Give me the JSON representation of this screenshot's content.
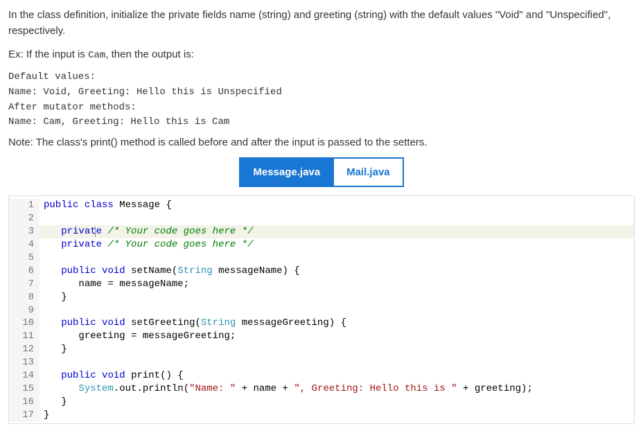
{
  "instructions": {
    "para1": "In the class definition, initialize the private fields name (string) and greeting (string) with the default values \"Void\" and \"Unspecified\", respectively.",
    "ex_prefix": "Ex: If the input is ",
    "ex_input": "Cam",
    "ex_suffix": ", then the output is:",
    "output": "Default values:\nName: Void, Greeting: Hello this is Unspecified\nAfter mutator methods:\nName: Cam, Greeting: Hello this is Cam",
    "note": "Note: The class's print() method is called before and after the input is passed to the setters."
  },
  "tabs": {
    "active": "Message.java",
    "inactive": "Mail.java"
  },
  "code": {
    "lines": [
      {
        "n": "1",
        "hl": false,
        "cursor": false,
        "indent": 0,
        "tokens": [
          {
            "c": "kw",
            "t": "public"
          },
          {
            "c": "sp",
            "t": " "
          },
          {
            "c": "kw",
            "t": "class"
          },
          {
            "c": "sp",
            "t": " "
          },
          {
            "c": "ident",
            "t": "Message"
          },
          {
            "c": "sp",
            "t": " "
          },
          {
            "c": "op",
            "t": "{"
          }
        ]
      },
      {
        "n": "2",
        "hl": false,
        "cursor": false,
        "indent": 0,
        "tokens": []
      },
      {
        "n": "3",
        "hl": true,
        "cursor": true,
        "indent": 1,
        "tokens": [
          {
            "c": "kw",
            "t": "private"
          },
          {
            "c": "sp",
            "t": " "
          },
          {
            "c": "cmt",
            "t": "/* Your code goes here */"
          }
        ]
      },
      {
        "n": "4",
        "hl": false,
        "cursor": false,
        "indent": 1,
        "tokens": [
          {
            "c": "kw",
            "t": "private"
          },
          {
            "c": "sp",
            "t": " "
          },
          {
            "c": "cmt",
            "t": "/* Your code goes here */"
          }
        ]
      },
      {
        "n": "5",
        "hl": false,
        "cursor": false,
        "indent": 0,
        "tokens": []
      },
      {
        "n": "6",
        "hl": false,
        "cursor": false,
        "indent": 1,
        "tokens": [
          {
            "c": "kw",
            "t": "public"
          },
          {
            "c": "sp",
            "t": " "
          },
          {
            "c": "kw",
            "t": "void"
          },
          {
            "c": "sp",
            "t": " "
          },
          {
            "c": "ident",
            "t": "setName"
          },
          {
            "c": "op",
            "t": "("
          },
          {
            "c": "type",
            "t": "String"
          },
          {
            "c": "sp",
            "t": " "
          },
          {
            "c": "ident",
            "t": "messageName"
          },
          {
            "c": "op",
            "t": ")"
          },
          {
            "c": "sp",
            "t": " "
          },
          {
            "c": "op",
            "t": "{"
          }
        ]
      },
      {
        "n": "7",
        "hl": false,
        "cursor": false,
        "indent": 2,
        "tokens": [
          {
            "c": "ident",
            "t": "name"
          },
          {
            "c": "sp",
            "t": " "
          },
          {
            "c": "op",
            "t": "="
          },
          {
            "c": "sp",
            "t": " "
          },
          {
            "c": "ident",
            "t": "messageName"
          },
          {
            "c": "op",
            "t": ";"
          }
        ]
      },
      {
        "n": "8",
        "hl": false,
        "cursor": false,
        "indent": 1,
        "tokens": [
          {
            "c": "op",
            "t": "}"
          }
        ]
      },
      {
        "n": "9",
        "hl": false,
        "cursor": false,
        "indent": 0,
        "tokens": []
      },
      {
        "n": "10",
        "hl": false,
        "cursor": false,
        "indent": 1,
        "tokens": [
          {
            "c": "kw",
            "t": "public"
          },
          {
            "c": "sp",
            "t": " "
          },
          {
            "c": "kw",
            "t": "void"
          },
          {
            "c": "sp",
            "t": " "
          },
          {
            "c": "ident",
            "t": "setGreeting"
          },
          {
            "c": "op",
            "t": "("
          },
          {
            "c": "type",
            "t": "String"
          },
          {
            "c": "sp",
            "t": " "
          },
          {
            "c": "ident",
            "t": "messageGreeting"
          },
          {
            "c": "op",
            "t": ")"
          },
          {
            "c": "sp",
            "t": " "
          },
          {
            "c": "op",
            "t": "{"
          }
        ]
      },
      {
        "n": "11",
        "hl": false,
        "cursor": false,
        "indent": 2,
        "tokens": [
          {
            "c": "ident",
            "t": "greeting"
          },
          {
            "c": "sp",
            "t": " "
          },
          {
            "c": "op",
            "t": "="
          },
          {
            "c": "sp",
            "t": " "
          },
          {
            "c": "ident",
            "t": "messageGreeting"
          },
          {
            "c": "op",
            "t": ";"
          }
        ]
      },
      {
        "n": "12",
        "hl": false,
        "cursor": false,
        "indent": 1,
        "tokens": [
          {
            "c": "op",
            "t": "}"
          }
        ]
      },
      {
        "n": "13",
        "hl": false,
        "cursor": false,
        "indent": 0,
        "tokens": []
      },
      {
        "n": "14",
        "hl": false,
        "cursor": false,
        "indent": 1,
        "tokens": [
          {
            "c": "kw",
            "t": "public"
          },
          {
            "c": "sp",
            "t": " "
          },
          {
            "c": "kw",
            "t": "void"
          },
          {
            "c": "sp",
            "t": " "
          },
          {
            "c": "ident",
            "t": "print"
          },
          {
            "c": "op",
            "t": "()"
          },
          {
            "c": "sp",
            "t": " "
          },
          {
            "c": "op",
            "t": "{"
          }
        ]
      },
      {
        "n": "15",
        "hl": false,
        "cursor": false,
        "indent": 2,
        "tokens": [
          {
            "c": "type",
            "t": "System"
          },
          {
            "c": "op",
            "t": "."
          },
          {
            "c": "ident",
            "t": "out"
          },
          {
            "c": "op",
            "t": "."
          },
          {
            "c": "ident",
            "t": "println"
          },
          {
            "c": "op",
            "t": "("
          },
          {
            "c": "str",
            "t": "\"Name: \""
          },
          {
            "c": "sp",
            "t": " "
          },
          {
            "c": "op",
            "t": "+"
          },
          {
            "c": "sp",
            "t": " "
          },
          {
            "c": "ident",
            "t": "name"
          },
          {
            "c": "sp",
            "t": " "
          },
          {
            "c": "op",
            "t": "+"
          },
          {
            "c": "sp",
            "t": " "
          },
          {
            "c": "str",
            "t": "\", Greeting: Hello this is \""
          },
          {
            "c": "sp",
            "t": " "
          },
          {
            "c": "op",
            "t": "+"
          },
          {
            "c": "sp",
            "t": " "
          },
          {
            "c": "ident",
            "t": "greeting"
          },
          {
            "c": "op",
            "t": ");"
          }
        ]
      },
      {
        "n": "16",
        "hl": false,
        "cursor": false,
        "indent": 1,
        "tokens": [
          {
            "c": "op",
            "t": "}"
          }
        ]
      },
      {
        "n": "17",
        "hl": false,
        "cursor": false,
        "indent": 0,
        "tokens": [
          {
            "c": "op",
            "t": "}"
          }
        ]
      }
    ]
  }
}
